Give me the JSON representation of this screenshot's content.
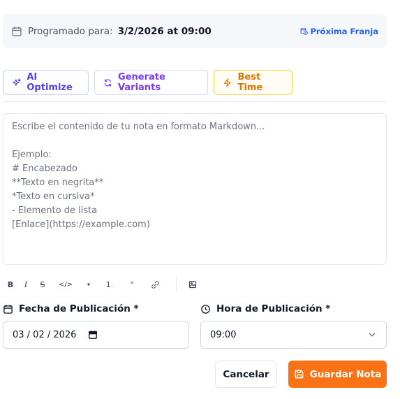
{
  "schedule": {
    "label": "Programado para:",
    "value": "3/2/2026 at 09:00",
    "next_slot": "Próxima Franja"
  },
  "ai_actions": {
    "optimize": "AI Optimize",
    "variants": "Generate Variants",
    "best_time": "Best Time"
  },
  "editor": {
    "placeholder": "Escribe el contenido de tu nota en formato Markdown...\n\nEjemplo:\n# Encabezado\n**Texto en negrita**\n*Texto en cursiva*\n- Elemento de lista\n[Enlace](https://example.com)"
  },
  "toolbar": {
    "bold": "B",
    "italic": "I",
    "strike": "S",
    "code": "</>",
    "bullet": "•",
    "numbered": "1.",
    "quote": "\""
  },
  "form": {
    "date_label": "Fecha de Publicación *",
    "date_value": "03 / 02 / 2026",
    "time_label": "Hora de Publicación *",
    "time_value": "09:00"
  },
  "actions": {
    "cancel": "Cancelar",
    "save": "Guardar Nota"
  },
  "colors": {
    "primary": "#f97316",
    "ai_optimize": "#4f46e5",
    "generate_variants": "#7c3aed",
    "best_time": "#d97706",
    "next_slot": "#2563eb"
  }
}
